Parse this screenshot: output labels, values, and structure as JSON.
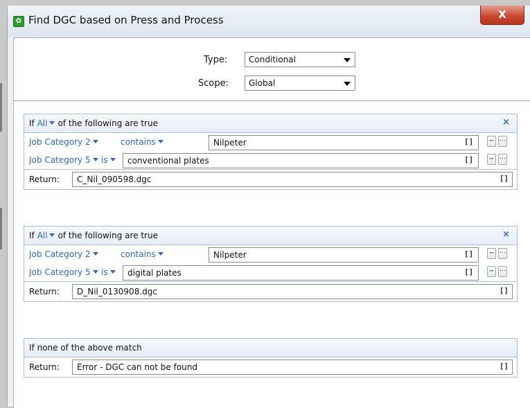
{
  "window": {
    "title": "Find DGC based on Press and Process",
    "close_label": "X"
  },
  "type_field": {
    "label": "Type:",
    "value": "Conditional"
  },
  "scope_field": {
    "label": "Scope:",
    "value": "Global"
  },
  "rules": [
    {
      "header": {
        "prefix": "If",
        "quantifier": "All",
        "suffix": "of the following are true",
        "remove": "×"
      },
      "conditions": [
        {
          "field": "Job Category 2",
          "operator": "contains",
          "value": "Nilpeter",
          "bracket": "[]"
        },
        {
          "field": "Job Category 5",
          "operator": "is",
          "value": "conventional plates",
          "bracket": "[]"
        }
      ],
      "return": {
        "label": "Return:",
        "value": "C_Nil_090598.dgc",
        "bracket": "[]"
      }
    },
    {
      "header": {
        "prefix": "If",
        "quantifier": "All",
        "suffix": "of the following are true",
        "remove": "×"
      },
      "conditions": [
        {
          "field": "Job Category 2",
          "operator": "contains",
          "value": "Nilpeter",
          "bracket": "[]"
        },
        {
          "field": "Job Category 5",
          "operator": "is",
          "value": "digital plates",
          "bracket": "[]"
        }
      ],
      "return": {
        "label": "Return:",
        "value": "D_Nil_0130908.dgc",
        "bracket": "[]"
      }
    }
  ],
  "fallback": {
    "header": "If none of the above match",
    "return": {
      "label": "Return:",
      "value": "Error - DGC can not be found",
      "bracket": "[]"
    }
  },
  "mini_buttons": {
    "remove": "−",
    "more": "···"
  },
  "colors": {
    "accent": "#2f67c7",
    "close": "#c8442e",
    "app_icon": "#2e9b2e"
  }
}
